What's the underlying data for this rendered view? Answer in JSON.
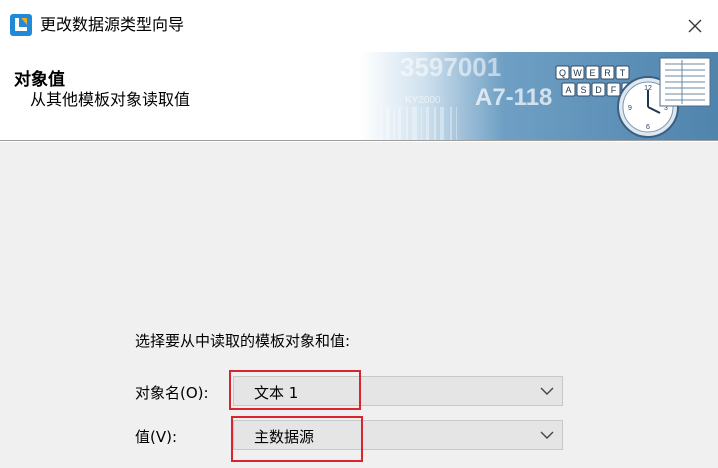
{
  "window": {
    "title": "更改数据源类型向导",
    "close_icon": "close-icon",
    "app_icon": "label-designer-icon"
  },
  "banner": {
    "title": "对象值",
    "subtitle": "从其他模板对象读取值",
    "art_icon": "keyboard-barcode-clock-illustration",
    "keys_row1": [
      "Q",
      "W",
      "E",
      "R",
      "T"
    ],
    "keys_row2": [
      "A",
      "S",
      "D",
      "F",
      "G"
    ],
    "bg_text1": "3597001",
    "bg_text2": "A7-118",
    "bg_text3": "KY2000"
  },
  "content": {
    "instruction": "选择要从中读取的模板对象和值:",
    "object_name": {
      "label": "对象名(O):",
      "value": "文本 1",
      "icon": "chevron-down-icon"
    },
    "value_field": {
      "label": "值(V):",
      "value": "主数据源",
      "icon": "chevron-down-icon"
    }
  },
  "colors": {
    "background": "#f0f0f0",
    "highlight": "#d9262e",
    "banner_blue": "#5b8fb8"
  }
}
